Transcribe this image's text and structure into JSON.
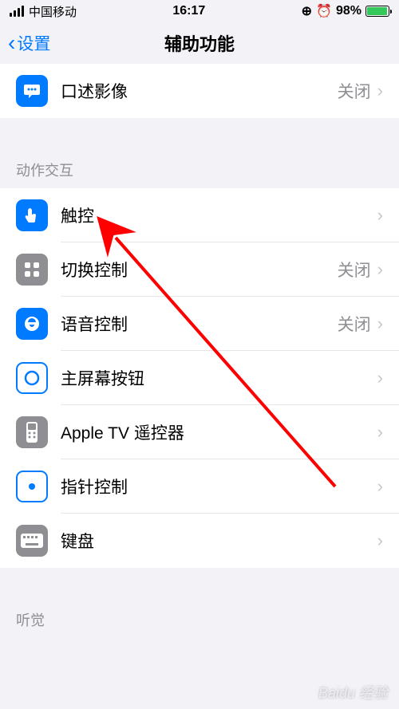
{
  "status": {
    "carrier": "中国移动",
    "time": "16:17",
    "battery_pct": "98%",
    "lock_icon": "⟳",
    "alarm_icon": "⏰"
  },
  "nav": {
    "back_label": "设置",
    "title": "辅助功能"
  },
  "section0": {
    "items": [
      {
        "label": "口述影像",
        "value": "关闭"
      }
    ]
  },
  "section1": {
    "header": "动作交互",
    "items": [
      {
        "label": "触控",
        "value": ""
      },
      {
        "label": "切换控制",
        "value": "关闭"
      },
      {
        "label": "语音控制",
        "value": "关闭"
      },
      {
        "label": "主屏幕按钮",
        "value": ""
      },
      {
        "label": "Apple TV 遥控器",
        "value": ""
      },
      {
        "label": "指针控制",
        "value": ""
      },
      {
        "label": "键盘",
        "value": ""
      }
    ]
  },
  "section2": {
    "header": "听觉"
  },
  "watermark": "Baidu 经验",
  "colors": {
    "accent": "#007aff",
    "secondary": "#8e8e93",
    "bg": "#f2f2f7"
  }
}
